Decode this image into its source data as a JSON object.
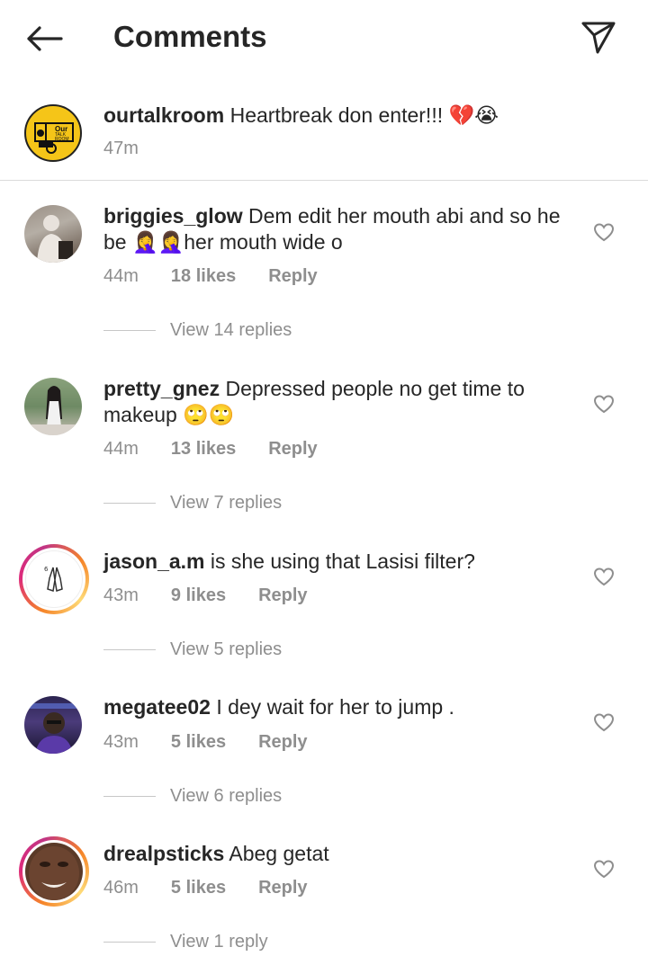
{
  "header": {
    "title": "Comments",
    "back_icon": "arrow-left-icon",
    "share_icon": "paper-plane-icon"
  },
  "caption": {
    "username": "ourtalkroom",
    "text": "Heartbreak don enter!!! 💔😭",
    "time": "47m",
    "logo_text": [
      "Our",
      "TALK",
      "ROOM"
    ]
  },
  "comments": [
    {
      "username": "briggies_glow",
      "text": "Dem edit her mouth abi and so he be 🤦‍♀️🤦‍♀️her mouth wide o",
      "time": "44m",
      "likes": "18 likes",
      "reply": "Reply",
      "view_replies": "View 14 replies"
    },
    {
      "username": "pretty_gnez",
      "text": "Depressed people no get time to makeup 🙄🙄",
      "time": "44m",
      "likes": "13 likes",
      "reply": "Reply",
      "view_replies": "View 7 replies"
    },
    {
      "username": "jason_a.m",
      "text": "is she using that Lasisi filter?",
      "time": "43m",
      "likes": "9 likes",
      "reply": "Reply",
      "view_replies": "View 5 replies"
    },
    {
      "username": "megatee02",
      "text": "I dey wait for her to jump .",
      "time": "43m",
      "likes": "5 likes",
      "reply": "Reply",
      "view_replies": "View 6 replies"
    },
    {
      "username": "drealpsticks",
      "text": "Abeg getat",
      "time": "46m",
      "likes": "5 likes",
      "reply": "Reply",
      "view_replies": "View 1 reply"
    }
  ],
  "colors": {
    "text": "#262626",
    "secondary": "#8e8e8e",
    "logo_yellow": "#f5c518"
  }
}
